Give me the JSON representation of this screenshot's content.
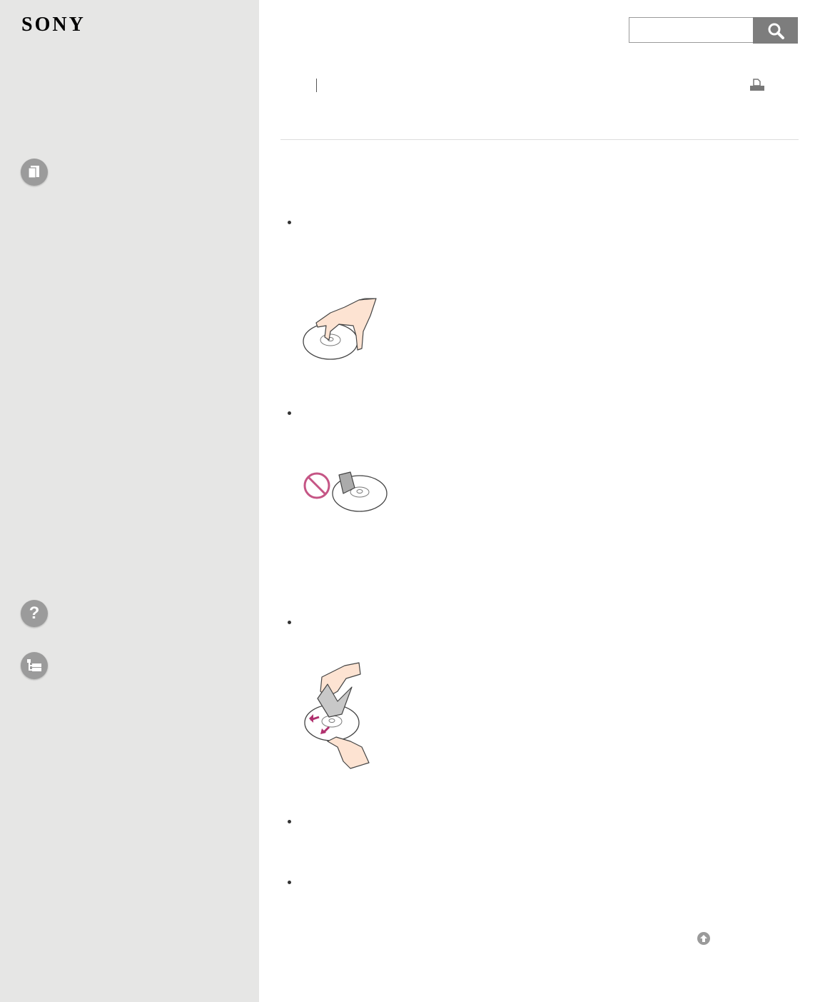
{
  "brand": {
    "logo_text": "SONY"
  },
  "search": {
    "placeholder": "",
    "value": ""
  },
  "sidebar": {
    "icons": [
      {
        "name": "manual-book-icon"
      },
      {
        "name": "help-question-icon"
      },
      {
        "name": "contents-tree-icon"
      }
    ]
  },
  "header": {
    "print_icon": "print-icon"
  },
  "content": {
    "bullets": 5,
    "illustrations": [
      {
        "name": "hand-holding-disc-illustration"
      },
      {
        "name": "no-sticker-on-disc-illustration"
      },
      {
        "name": "wiping-disc-illustration"
      }
    ],
    "prohibition_color": "#c55585",
    "arrow_color": "#b0306e",
    "skin_color": "#fde3d2"
  },
  "footer": {
    "back_to_top_icon": "arrow-up-icon"
  },
  "colors": {
    "sidebar_bg": "#e6e6e5",
    "icon_bg": "#9b9b9b",
    "search_button_bg": "#7d7d7d"
  }
}
